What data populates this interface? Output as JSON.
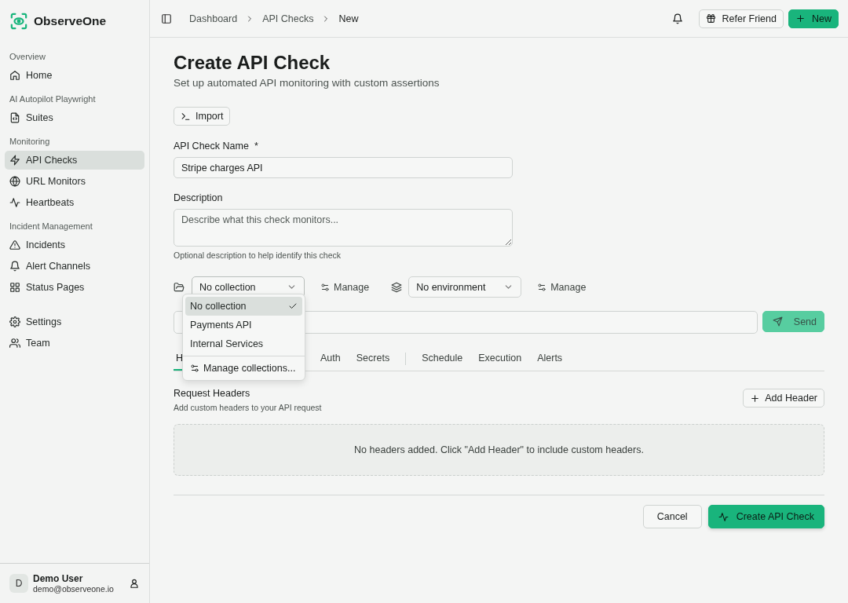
{
  "brand": {
    "name": "ObserveOne"
  },
  "sidebar": {
    "sections": [
      {
        "title": "Overview",
        "items": [
          {
            "label": "Home",
            "selected": false
          }
        ]
      },
      {
        "title": "AI Autopilot Playwright",
        "items": [
          {
            "label": "Suites",
            "selected": false
          }
        ]
      },
      {
        "title": "Monitoring",
        "items": [
          {
            "label": "API Checks",
            "selected": true
          },
          {
            "label": "URL Monitors",
            "selected": false
          },
          {
            "label": "Heartbeats",
            "selected": false
          }
        ]
      },
      {
        "title": "Incident Management",
        "items": [
          {
            "label": "Incidents",
            "selected": false
          },
          {
            "label": "Alert Channels",
            "selected": false
          },
          {
            "label": "Status Pages",
            "selected": false
          }
        ]
      },
      {
        "items": [
          {
            "label": "Settings",
            "selected": false
          },
          {
            "label": "Team",
            "selected": false
          }
        ]
      }
    ]
  },
  "user": {
    "initial": "D",
    "name": "Demo User",
    "email": "demo@observeone.io"
  },
  "breadcrumbs": [
    "Dashboard",
    "API Checks",
    "New"
  ],
  "header_buttons": [
    {
      "label": "Refer Friend",
      "kind": "outline"
    },
    {
      "label": "New",
      "kind": "primary"
    }
  ],
  "page": {
    "title": "Create API Check",
    "subtitle": "Set up automated API monitoring with custom assertions"
  },
  "import_button": "Import",
  "name_field": {
    "label": "API Check Name",
    "required_mark": "*",
    "value": "Stripe charges API"
  },
  "description_field": {
    "label": "Description",
    "placeholder": "Describe what this check monitors...",
    "hint": "Optional description to help identify this check"
  },
  "collection_select": {
    "value": "No collection",
    "manage": "Manage",
    "expanded": true
  },
  "environment_select": {
    "value": "No environment",
    "manage": "Manage"
  },
  "collection_menu": {
    "options": [
      {
        "label": "No collection",
        "selected": true
      },
      {
        "label": "Payments API",
        "selected": false
      },
      {
        "label": "Internal Services",
        "selected": false
      }
    ],
    "footer": "Manage collections..."
  },
  "send_button": {
    "label": "Send",
    "disabled": true
  },
  "tab_groups": [
    {
      "tabs": [
        {
          "label": "H",
          "selected": true
        },
        {
          "label": "Auth",
          "selected": false
        },
        {
          "label": "Secrets",
          "selected": false
        }
      ]
    },
    {
      "tabs": [
        {
          "label": "Schedule",
          "selected": false
        },
        {
          "label": "Execution",
          "selected": false
        },
        {
          "label": "Alerts",
          "selected": false
        }
      ]
    }
  ],
  "headers_section": {
    "title": "Request Headers",
    "subtitle": "Add custom headers to your API request",
    "add_button": "Add Header",
    "empty_text": "No headers added. Click \"Add Header\" to include custom headers."
  },
  "footer_buttons": [
    {
      "label": "Cancel",
      "kind": "outline"
    },
    {
      "label": "Create API Check",
      "kind": "primary"
    }
  ]
}
